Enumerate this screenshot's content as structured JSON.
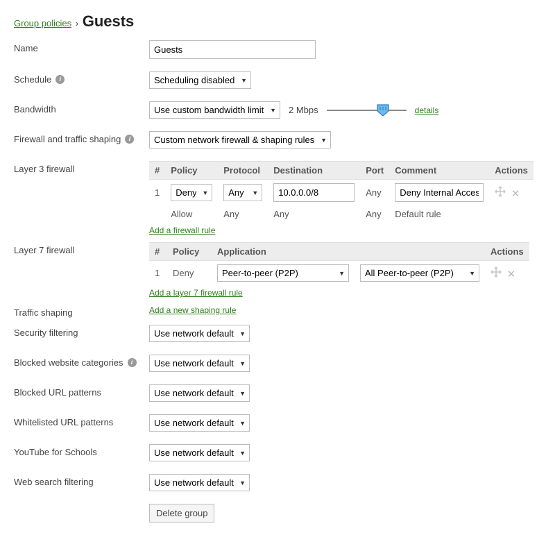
{
  "breadcrumb": {
    "parent": "Group policies",
    "sep": "›",
    "current": "Guests"
  },
  "labels": {
    "name": "Name",
    "schedule": "Schedule",
    "bandwidth": "Bandwidth",
    "firewall_shaping": "Firewall and traffic shaping",
    "l3": "Layer 3 firewall",
    "l7": "Layer 7 firewall",
    "traffic_shaping": "Traffic shaping",
    "security_filtering": "Security filtering",
    "blocked_cat": "Blocked website categories",
    "blocked_url": "Blocked URL patterns",
    "whitelist_url": "Whitelisted URL patterns",
    "youtube": "YouTube for Schools",
    "websearch": "Web search filtering"
  },
  "name_value": "Guests",
  "schedule_value": "Scheduling disabled",
  "bandwidth": {
    "select_value": "Use custom bandwidth limit",
    "value_text": "2 Mbps",
    "details": "details"
  },
  "firewall_shaping_value": "Custom network firewall & shaping rules",
  "l3": {
    "headers": {
      "num": "#",
      "policy": "Policy",
      "protocol": "Protocol",
      "destination": "Destination",
      "port": "Port",
      "comment": "Comment",
      "actions": "Actions"
    },
    "rows": [
      {
        "num": "1",
        "policy": "Deny",
        "protocol": "Any",
        "destination": "10.0.0.0/8",
        "port": "Any",
        "comment": "Deny Internal Access"
      }
    ],
    "default_row": {
      "policy": "Allow",
      "protocol": "Any",
      "destination": "Any",
      "port": "Any",
      "comment": "Default rule"
    },
    "add_link": "Add a firewall rule"
  },
  "l7": {
    "headers": {
      "num": "#",
      "policy": "Policy",
      "application": "Application",
      "actions": "Actions"
    },
    "rows": [
      {
        "num": "1",
        "policy": "Deny",
        "app_category": "Peer-to-peer (P2P)",
        "app_item": "All Peer-to-peer (P2P)"
      }
    ],
    "add_link": "Add a layer 7 firewall rule"
  },
  "traffic_shaping_link": "Add a new shaping rule",
  "default_select": "Use network default",
  "delete_button": "Delete group"
}
